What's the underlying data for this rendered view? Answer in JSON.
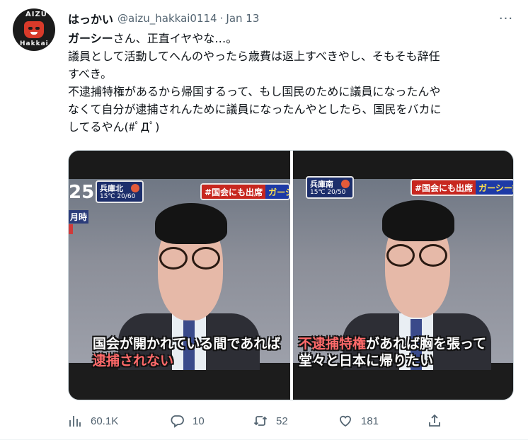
{
  "tweet": {
    "display_name": "はっかい",
    "handle": "@aizu_hakkai0114",
    "separator": "·",
    "date": "Jan 13",
    "more_label": "···",
    "avatar": {
      "top_text": "AIZU",
      "bottom_text": "Hakkai"
    },
    "text": {
      "line1_bold": "ガーシー",
      "line1_rest": "さん、正直イヤやな…。",
      "line2": "議員として活動してへんのやったら歳費は返上すべきやし、そもそも辞任",
      "line3": "すべき。",
      "line4": "不逮捕特権があるから帰国するって、もし国民のために議員になったんや",
      "line5": "なくて自分が逮捕されんために議員になったんやとしたら、国民をバカに",
      "line6": "してるやん(#ﾟДﾟ)"
    }
  },
  "media": {
    "left": {
      "ticker_num": "25",
      "ticker_side": "月時",
      "weather_line1": "兵庫北",
      "weather_line2": "15℃  20/60",
      "banner_tag": "#国会にも出席",
      "banner_rest": "ガーシ",
      "subtitle_line1": "国会が開かれている間であれば",
      "subtitle_line2": "逮捕されない"
    },
    "right": {
      "weather_line1": "兵庫南",
      "weather_line2": "15℃  20/50",
      "banner_tag": "#国会にも出席",
      "banner_rest": "ガーシー議",
      "subtitle_line1_red": "不逮捕特権",
      "subtitle_line1_white": "があれば胸を張って",
      "subtitle_line2": "堂々と日本に帰りたい"
    }
  },
  "actions": {
    "views": {
      "icon": "views-icon",
      "count": "60.1K"
    },
    "reply": {
      "icon": "reply-icon",
      "count": "10"
    },
    "retweet": {
      "icon": "retweet-icon",
      "count": "52"
    },
    "like": {
      "icon": "heart-icon",
      "count": "181"
    },
    "share": {
      "icon": "share-icon"
    }
  },
  "colors": {
    "text_primary": "#0f1419",
    "text_secondary": "#536471",
    "border": "#cfd9de",
    "banner_red": "#c7271f",
    "banner_blue": "#1d3aa6"
  }
}
